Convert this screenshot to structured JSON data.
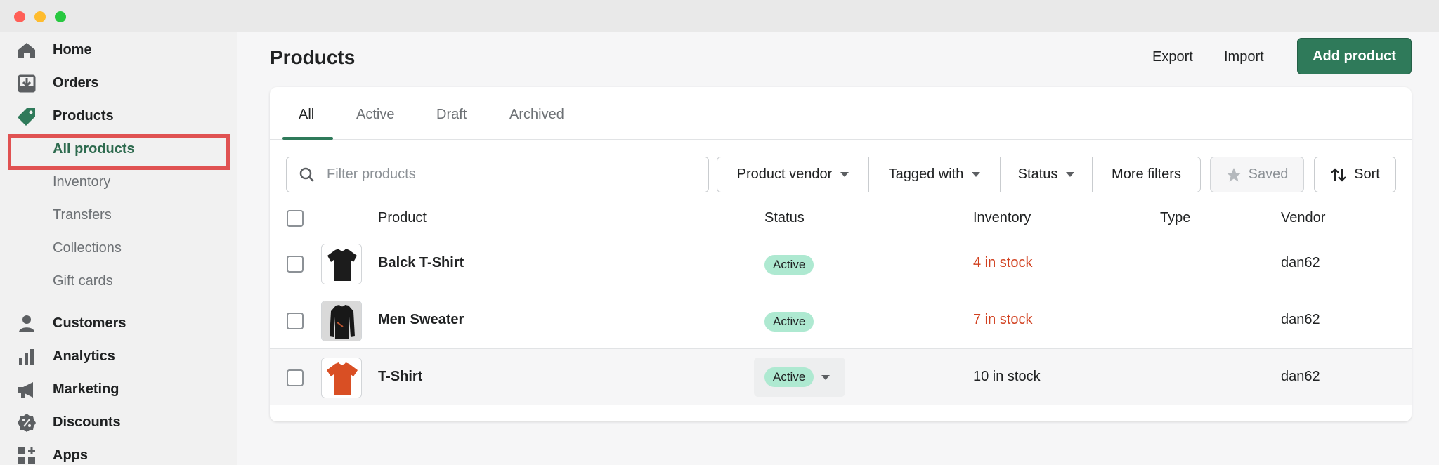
{
  "colors": {
    "accent": "#2f7a5a",
    "low_stock": "#d1401f",
    "badge_active": "#aee9d1",
    "highlight": "#e05252"
  },
  "sidebar": {
    "items": [
      {
        "label": "Home",
        "icon": "home-icon"
      },
      {
        "label": "Orders",
        "icon": "orders-icon"
      },
      {
        "label": "Products",
        "icon": "tag-icon"
      }
    ],
    "sub_items": [
      "All products",
      "Inventory",
      "Transfers",
      "Collections",
      "Gift cards"
    ],
    "items_lower": [
      {
        "label": "Customers",
        "icon": "person-icon"
      },
      {
        "label": "Analytics",
        "icon": "bar-chart-icon"
      },
      {
        "label": "Marketing",
        "icon": "megaphone-icon"
      },
      {
        "label": "Discounts",
        "icon": "discount-icon"
      },
      {
        "label": "Apps",
        "icon": "apps-icon"
      }
    ]
  },
  "header": {
    "title": "Products",
    "export": "Export",
    "import": "Import",
    "add_product": "Add product"
  },
  "tabs": [
    "All",
    "Active",
    "Draft",
    "Archived"
  ],
  "filters": {
    "search_placeholder": "Filter products",
    "vendor": "Product vendor",
    "tagged": "Tagged with",
    "status": "Status",
    "more": "More filters",
    "saved": "Saved",
    "sort": "Sort"
  },
  "table": {
    "columns": [
      "Product",
      "Status",
      "Inventory",
      "Type",
      "Vendor"
    ],
    "rows": [
      {
        "name": "Balck T-Shirt",
        "status": "Active",
        "inventory": "4 in stock",
        "type": "",
        "vendor": "dan62"
      },
      {
        "name": "Men Sweater",
        "status": "Active",
        "inventory": "7 in stock",
        "type": "",
        "vendor": "dan62"
      },
      {
        "name": "T-Shirt",
        "status": "Active",
        "inventory": "10 in stock",
        "type": "",
        "vendor": "dan62"
      }
    ]
  }
}
